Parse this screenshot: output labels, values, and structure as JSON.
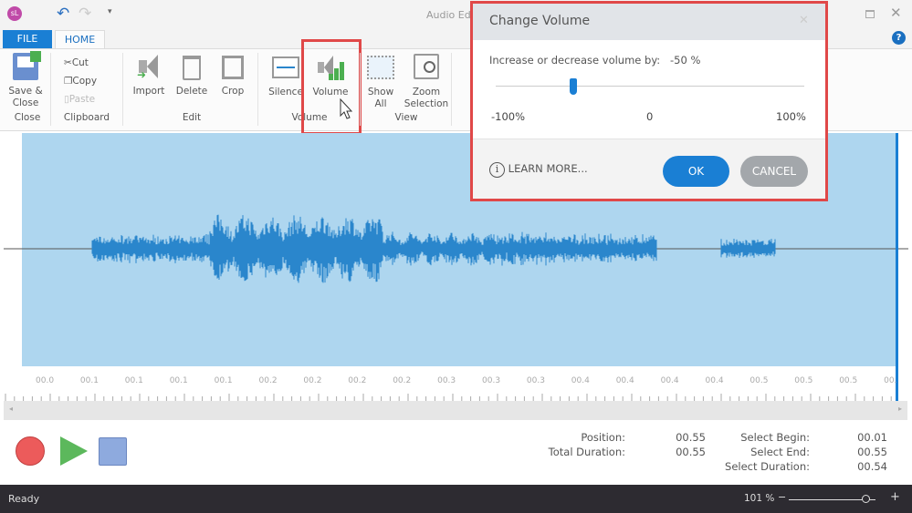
{
  "app": {
    "logo": "sL",
    "title": "Audio Ed",
    "icons": [
      "undo-icon",
      "redo-icon",
      "customize-icon",
      "maximize-icon",
      "close-icon",
      "help-icon"
    ]
  },
  "tabs": [
    {
      "label": "FILE"
    },
    {
      "label": "HOME"
    }
  ],
  "ribbon": {
    "save_close": "Save &\nClose",
    "cut": "Cut",
    "copy": "Copy",
    "paste": "Paste",
    "import": "Import",
    "delete": "Delete",
    "crop": "Crop",
    "silence": "Silence",
    "volume": "Volume",
    "show_all": "Show\nAll",
    "zoom_selection": "Zoom\nSelection",
    "groups": {
      "close": "Close",
      "clipboard": "Clipboard",
      "edit": "Edit",
      "volume": "Volume",
      "view": "View"
    }
  },
  "ruler": {
    "labels": [
      "00.0",
      "00.1",
      "00.1",
      "00.1",
      "00.1",
      "00.2",
      "00.2",
      "00.2",
      "00.2",
      "00.3",
      "00.3",
      "00.3",
      "00.4",
      "00.4",
      "00.4",
      "00.4",
      "00.5",
      "00.5",
      "00.5",
      "00."
    ]
  },
  "info": {
    "position_label": "Position:",
    "position": "00.55",
    "total_label": "Total Duration:",
    "total": "00.55",
    "sel_begin_label": "Select Begin:",
    "sel_begin": "00.01",
    "sel_end_label": "Select End:",
    "sel_end": "00.55",
    "sel_dur_label": "Select Duration:",
    "sel_dur": "00.54"
  },
  "status": {
    "text": "Ready",
    "zoom": "101 %",
    "zoom_minus": "−",
    "zoom_plus": "+",
    "zoom_fraction": 0.88
  },
  "dialog": {
    "title": "Change Volume",
    "prompt": "Increase or decrease volume by:",
    "value": "-50 %",
    "slider_value": -50,
    "min_label": "-100%",
    "mid_label": "0",
    "max_label": "100%",
    "learn_more": "LEARN MORE...",
    "ok": "OK",
    "cancel": "CANCEL"
  },
  "colors": {
    "accent": "#1a7fd4",
    "wave_bg": "#aed6ef",
    "wave": "#2a86cc",
    "highlight": "#e04848"
  }
}
